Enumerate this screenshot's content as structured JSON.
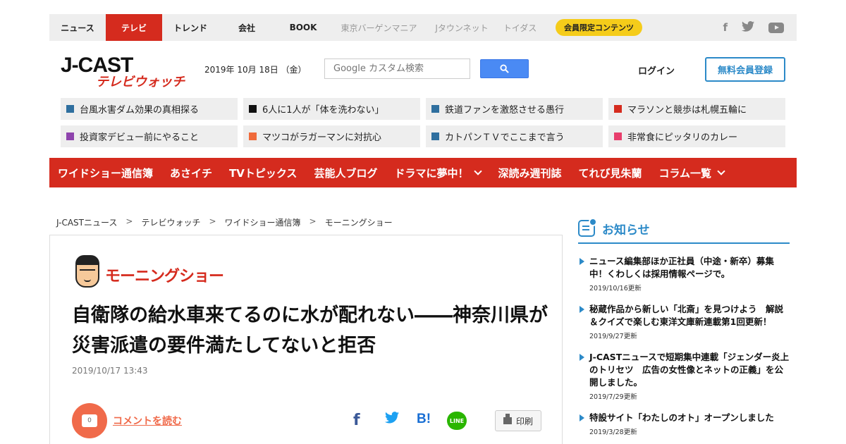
{
  "topnav": {
    "items": [
      {
        "label": "ニュース"
      },
      {
        "label": "テレビ"
      },
      {
        "label": "トレンド"
      },
      {
        "label": "会社"
      },
      {
        "label": "BOOK"
      },
      {
        "label": "東京バーゲンマニア"
      },
      {
        "label": "Jタウンネット"
      },
      {
        "label": "トイダス"
      }
    ],
    "member_badge": "会員限定コンテンツ",
    "social": [
      "facebook-icon",
      "twitter-icon",
      "youtube-icon"
    ],
    "social_f": "f"
  },
  "header": {
    "logo_main": "J-CAST",
    "logo_sub": "テレビウォッチ",
    "date": "2019年 10月 18日 （金）",
    "search_placeholder": "Google カスタム検索",
    "login": "ログイン",
    "register": "無料会員登録"
  },
  "tags": [
    {
      "label": "台風水害ダム効果の真相探る",
      "color": "#2f6f9f"
    },
    {
      "label": "6人に1人が「体を洗わない」",
      "color": "#111111"
    },
    {
      "label": "鉄道ファンを激怒させる愚行",
      "color": "#2f6f9f"
    },
    {
      "label": "マラソンと競歩は札幌五輪に",
      "color": "#d52b1e"
    },
    {
      "label": "投資家デビュー前にやること",
      "color": "#8e44ad"
    },
    {
      "label": "マツコがラガーマンに対抗心",
      "color": "#f06a3a"
    },
    {
      "label": "カトパンＴＶでここまで言う",
      "color": "#2f6f9f"
    },
    {
      "label": "非常食にピッタリのカレー",
      "color": "#e83e6c"
    }
  ],
  "rednav": {
    "items": [
      {
        "label": "ワイドショー通信簿"
      },
      {
        "label": "あさイチ"
      },
      {
        "label": "TVトピックス"
      },
      {
        "label": "芸能人ブログ"
      },
      {
        "label": "ドラマに夢中！"
      },
      {
        "label": "深読み週刊誌"
      },
      {
        "label": "てれび見朱蘭"
      },
      {
        "label": "コラム一覧"
      }
    ]
  },
  "breadcrumb": {
    "items": [
      "J-CASTニュース",
      "テレビウォッチ",
      "ワイドショー通信簿",
      "モーニングショー"
    ],
    "sep": ">"
  },
  "article": {
    "program": "モーニングショー",
    "headline": "自衛隊の給水車来てるのに水が配れない――神奈川県が災害派遣の要件満たしてないと拒否",
    "date": "2019/10/17 13:43",
    "comment_count": "0",
    "comment_link": "コメントを読む",
    "share_fb": "f",
    "share_hb": "B!",
    "share_line": "LINE",
    "print": "印刷"
  },
  "sidebar": {
    "title": "お知らせ",
    "notices": [
      {
        "text": "ニュース編集部ほか正社員（中途・新卒）募集中！くわしくは採用情報ページで。",
        "date": "2019/10/16更新"
      },
      {
        "text": "秘蔵作品から新しい「北斎」を見つけよう　解説＆クイズで楽しむ東洋文庫新連載第1回更新！",
        "date": "2019/9/27更新"
      },
      {
        "text": "J-CASTニュースで短期集中連載「ジェンダー炎上のトリセツ　広告の女性像とネットの正義」を公開しました。",
        "date": "2019/7/29更新"
      },
      {
        "text": "特設サイト「わたしのオト」オープンしました",
        "date": "2019/3/28更新"
      }
    ]
  },
  "colors": {
    "brand_red": "#d52b1e",
    "accent_blue": "#2c8ac8",
    "badge_yellow": "#f5cc1a"
  }
}
